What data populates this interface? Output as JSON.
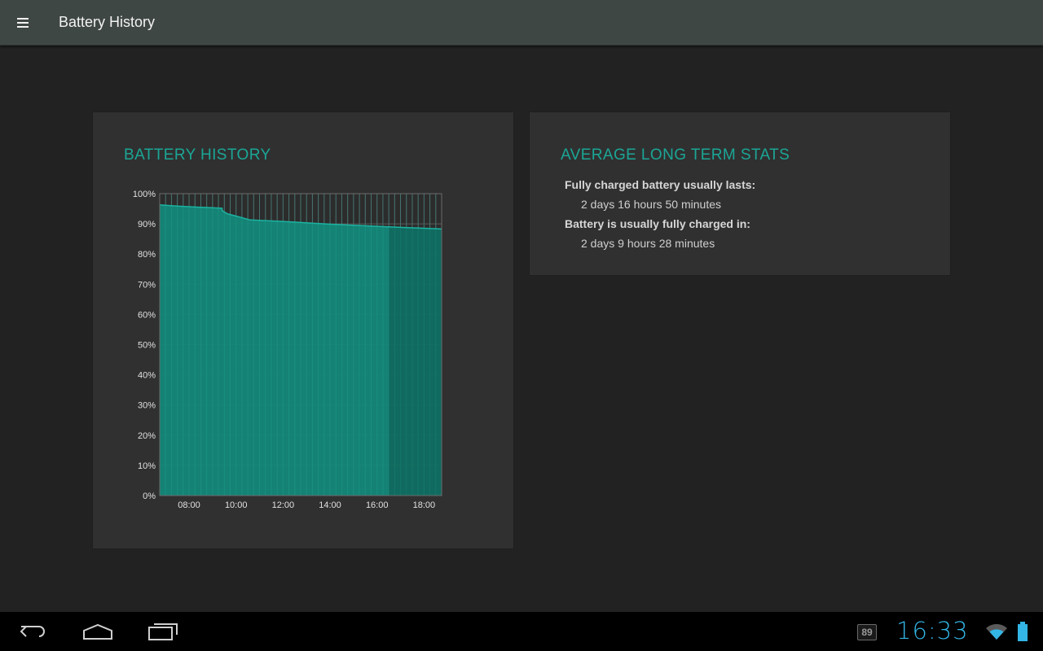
{
  "app": {
    "title": "Battery History",
    "menu_icon": "hamburger-menu-icon"
  },
  "history_card": {
    "title": "BATTERY HISTORY"
  },
  "chart_data": {
    "type": "area",
    "title": "",
    "xlabel": "",
    "ylabel": "",
    "x_ticks": [
      "08:00",
      "10:00",
      "12:00",
      "14:00",
      "16:00",
      "18:00"
    ],
    "y_ticks": [
      "0%",
      "10%",
      "20%",
      "30%",
      "40%",
      "50%",
      "60%",
      "70%",
      "80%",
      "90%",
      "100%"
    ],
    "ylim": [
      0,
      100
    ],
    "xlim_hours": [
      6.75,
      18.75
    ],
    "grid": true,
    "series": [
      {
        "color": "#12897a",
        "points": [
          {
            "x": 6.75,
            "y": 96.3
          },
          {
            "x": 7.5,
            "y": 95.9
          },
          {
            "x": 8.5,
            "y": 95.5
          },
          {
            "x": 9.4,
            "y": 95.2
          },
          {
            "x": 9.42,
            "y": 94.3
          },
          {
            "x": 9.65,
            "y": 93.3
          },
          {
            "x": 10.0,
            "y": 92.6
          },
          {
            "x": 10.6,
            "y": 91.3
          },
          {
            "x": 12.0,
            "y": 90.8
          },
          {
            "x": 14.0,
            "y": 89.9
          },
          {
            "x": 16.5,
            "y": 89.0
          },
          {
            "x": 18.75,
            "y": 88.3
          }
        ]
      }
    ],
    "shaded_from_hour": 16.5
  },
  "stats_card": {
    "title": "AVERAGE LONG TERM STATS",
    "items": [
      {
        "label": "Fully charged battery usually lasts:",
        "value": "2 days 16 hours 50 minutes"
      },
      {
        "label": "Battery is usually fully charged in:",
        "value": "2 days 9 hours 28 minutes"
      }
    ]
  },
  "navbar": {
    "back_icon": "back-icon",
    "home_icon": "home-icon",
    "recents_icon": "recent-apps-icon"
  },
  "status": {
    "notification_count": "89",
    "time": "16:33",
    "accent": "#33b5e5"
  }
}
